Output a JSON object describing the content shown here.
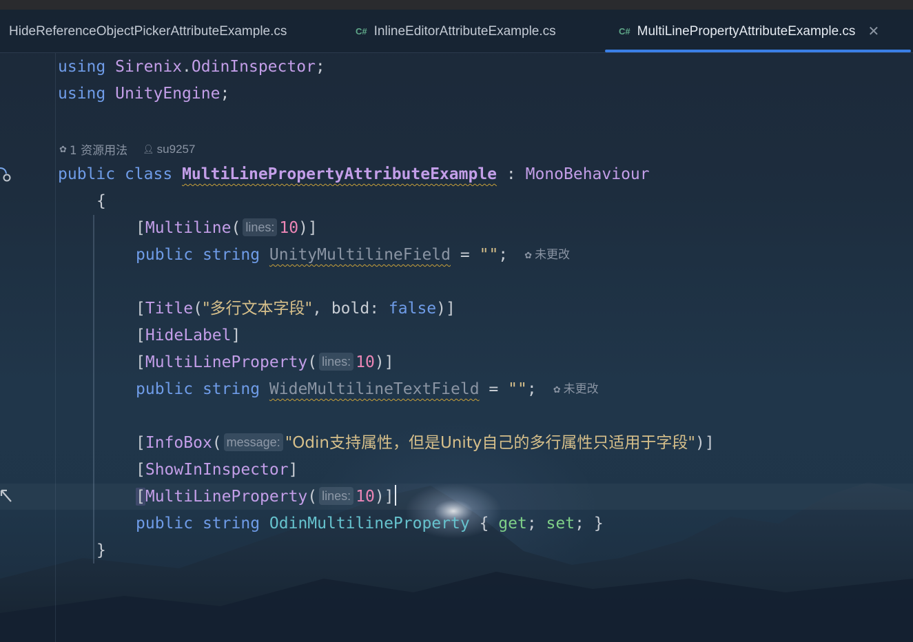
{
  "tabs": [
    {
      "icon": "",
      "label": "HideReferenceObjectPickerAttributeExample.cs",
      "active": false
    },
    {
      "icon": "C#",
      "label": "InlineEditorAttributeExample.cs",
      "active": false
    },
    {
      "icon": "C#",
      "label": "MultiLinePropertyAttributeExample.cs",
      "active": true,
      "close": "✕"
    }
  ],
  "editor": {
    "using1": {
      "kw": "using",
      "ns1": "Sirenix",
      "dot": ".",
      "ns2": "OdinInspector",
      "end": ";"
    },
    "using2": {
      "kw": "using",
      "ns": "UnityEngine",
      "end": ";"
    },
    "code_lens": {
      "usages": "1 资源用法",
      "author": "su9257"
    },
    "class_decl": {
      "kw1": "public",
      "kw2": "class",
      "name": "MultiLinePropertyAttributeExample",
      "colon": ":",
      "base": "MonoBehaviour"
    },
    "open_brace": "{",
    "close_brace": "}",
    "l_attr1": {
      "open": "[",
      "name": "Multiline",
      "paren": "(",
      "hint": "lines:",
      "value": "10",
      "close": ")]"
    },
    "l_field1": {
      "kw1": "public",
      "kw2": "string",
      "name": "UnityMultilineField",
      "eq": "=",
      "value": "\"\"",
      "end": ";",
      "status": "未更改"
    },
    "l_title": {
      "open": "[",
      "name": "Title",
      "paren": "(",
      "text": "\"多行文本字段\"",
      "sep": ", bold: ",
      "flag": "false",
      "close": ")]"
    },
    "l_hidelabel": {
      "open": "[",
      "name": "HideLabel",
      "close": "]"
    },
    "l_attr2": {
      "open": "[",
      "name": "MultiLineProperty",
      "paren": "(",
      "hint": "lines:",
      "value": "10",
      "close": ")]"
    },
    "l_field2": {
      "kw1": "public",
      "kw2": "string",
      "name": "WideMultilineTextField",
      "eq": "=",
      "value": "\"\"",
      "end": ";",
      "status": "未更改"
    },
    "l_infobox": {
      "open": "[",
      "name": "InfoBox",
      "paren": "(",
      "hint": "message:",
      "text": "\"Odin支持属性，但是Unity自己的多行属性只适用于字段\"",
      "close": ")]"
    },
    "l_showin": {
      "open": "[",
      "name": "ShowInInspector",
      "close": "]"
    },
    "l_attr3": {
      "open": "[",
      "name": "MultiLineProperty",
      "paren": "(",
      "hint": "lines:",
      "value": "10",
      "close": ")]"
    },
    "l_prop": {
      "kw1": "public",
      "kw2": "string",
      "name": "OdinMultilineProperty",
      "ob": "{",
      "get": "get",
      "semi1": ";",
      "set": "set",
      "semi2": ";",
      "cb": "}"
    }
  },
  "colors": {
    "keyword": "#6f9ce8",
    "type": "#c39ee8",
    "field": "#66c2cd",
    "number": "#ec86b6",
    "string": "#d6bf8a",
    "accent": "#3a7fe6"
  }
}
